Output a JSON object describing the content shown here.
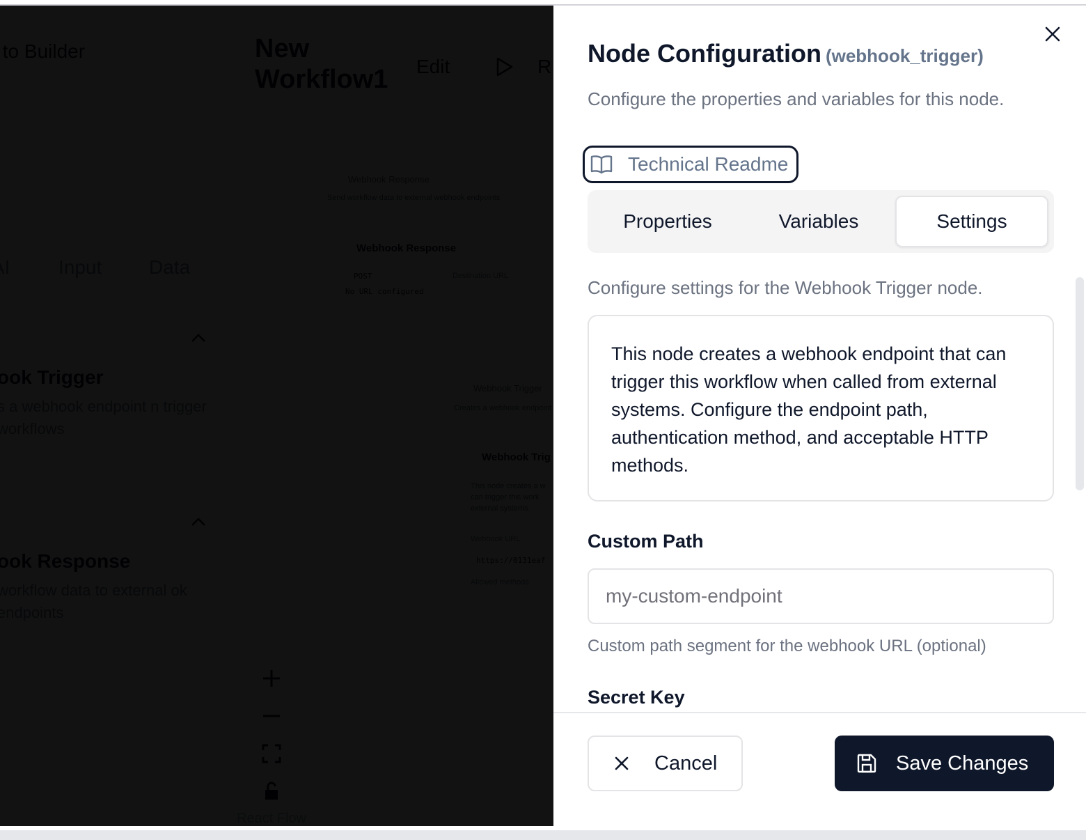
{
  "builder": {
    "back_label": "k to Builder",
    "workflow_title": "New Workflow1",
    "edit_label": "Edit",
    "run_label": "R",
    "category_tabs": [
      "AI",
      "Input",
      "Data"
    ],
    "panel_items": [
      {
        "title": "ook Trigger",
        "description": "s a webhook endpoint n trigger workflows"
      },
      {
        "title": "ook Response",
        "description": "workflow data to external ok endpoints"
      }
    ],
    "canvas_nodes": {
      "webhook_response_header": "Webhook Response",
      "webhook_response_desc": "Send workflow data to external webhook endpoints",
      "webhook_response_node": "Webhook Response",
      "method": "POST",
      "destination_label": "Destination URL",
      "no_url": "No URL configured",
      "webhook_trigger_header": "Webhook Trigger",
      "webhook_trigger_desc": "Creates a webhook endpoint",
      "webhook_trigger_node": "Webhook Trig",
      "trigger_desc": "This node creates a w can trigger this work external systems.",
      "webhook_url_label": "Webhook URL",
      "webhook_url_value": "https://0131eaf",
      "allowed_methods": "Allowed methods"
    },
    "react_flow_label": "React Flow"
  },
  "sheet": {
    "title": "Node Configuration",
    "node_type": "(webhook_trigger)",
    "description": "Configure the properties and variables for this node.",
    "readme_label": "Technical Readme",
    "tabs": [
      {
        "label": "Properties",
        "active": false
      },
      {
        "label": "Variables",
        "active": false
      },
      {
        "label": "Settings",
        "active": true
      }
    ],
    "settings_description": "Configure settings for the Webhook Trigger node.",
    "info_text": "This node creates a webhook endpoint that can trigger this workflow when called from external systems. Configure the endpoint path, authentication method, and acceptable HTTP methods.",
    "custom_path": {
      "label": "Custom Path",
      "value": "",
      "placeholder": "my-custom-endpoint",
      "help": "Custom path segment for the webhook URL (optional)"
    },
    "secret_key": {
      "label": "Secret Key"
    },
    "footer": {
      "cancel_label": "Cancel",
      "save_label": "Save Changes"
    }
  },
  "icons": {
    "close": "close-icon",
    "readme": "book-open-icon",
    "cancel": "x-icon",
    "save": "save-icon",
    "run": "play-icon"
  },
  "colors": {
    "primary": "#0f172a",
    "muted_text": "#6b7280",
    "border": "#e4e4e7",
    "tab_bg": "#f4f4f5",
    "overlay": "#000000"
  }
}
